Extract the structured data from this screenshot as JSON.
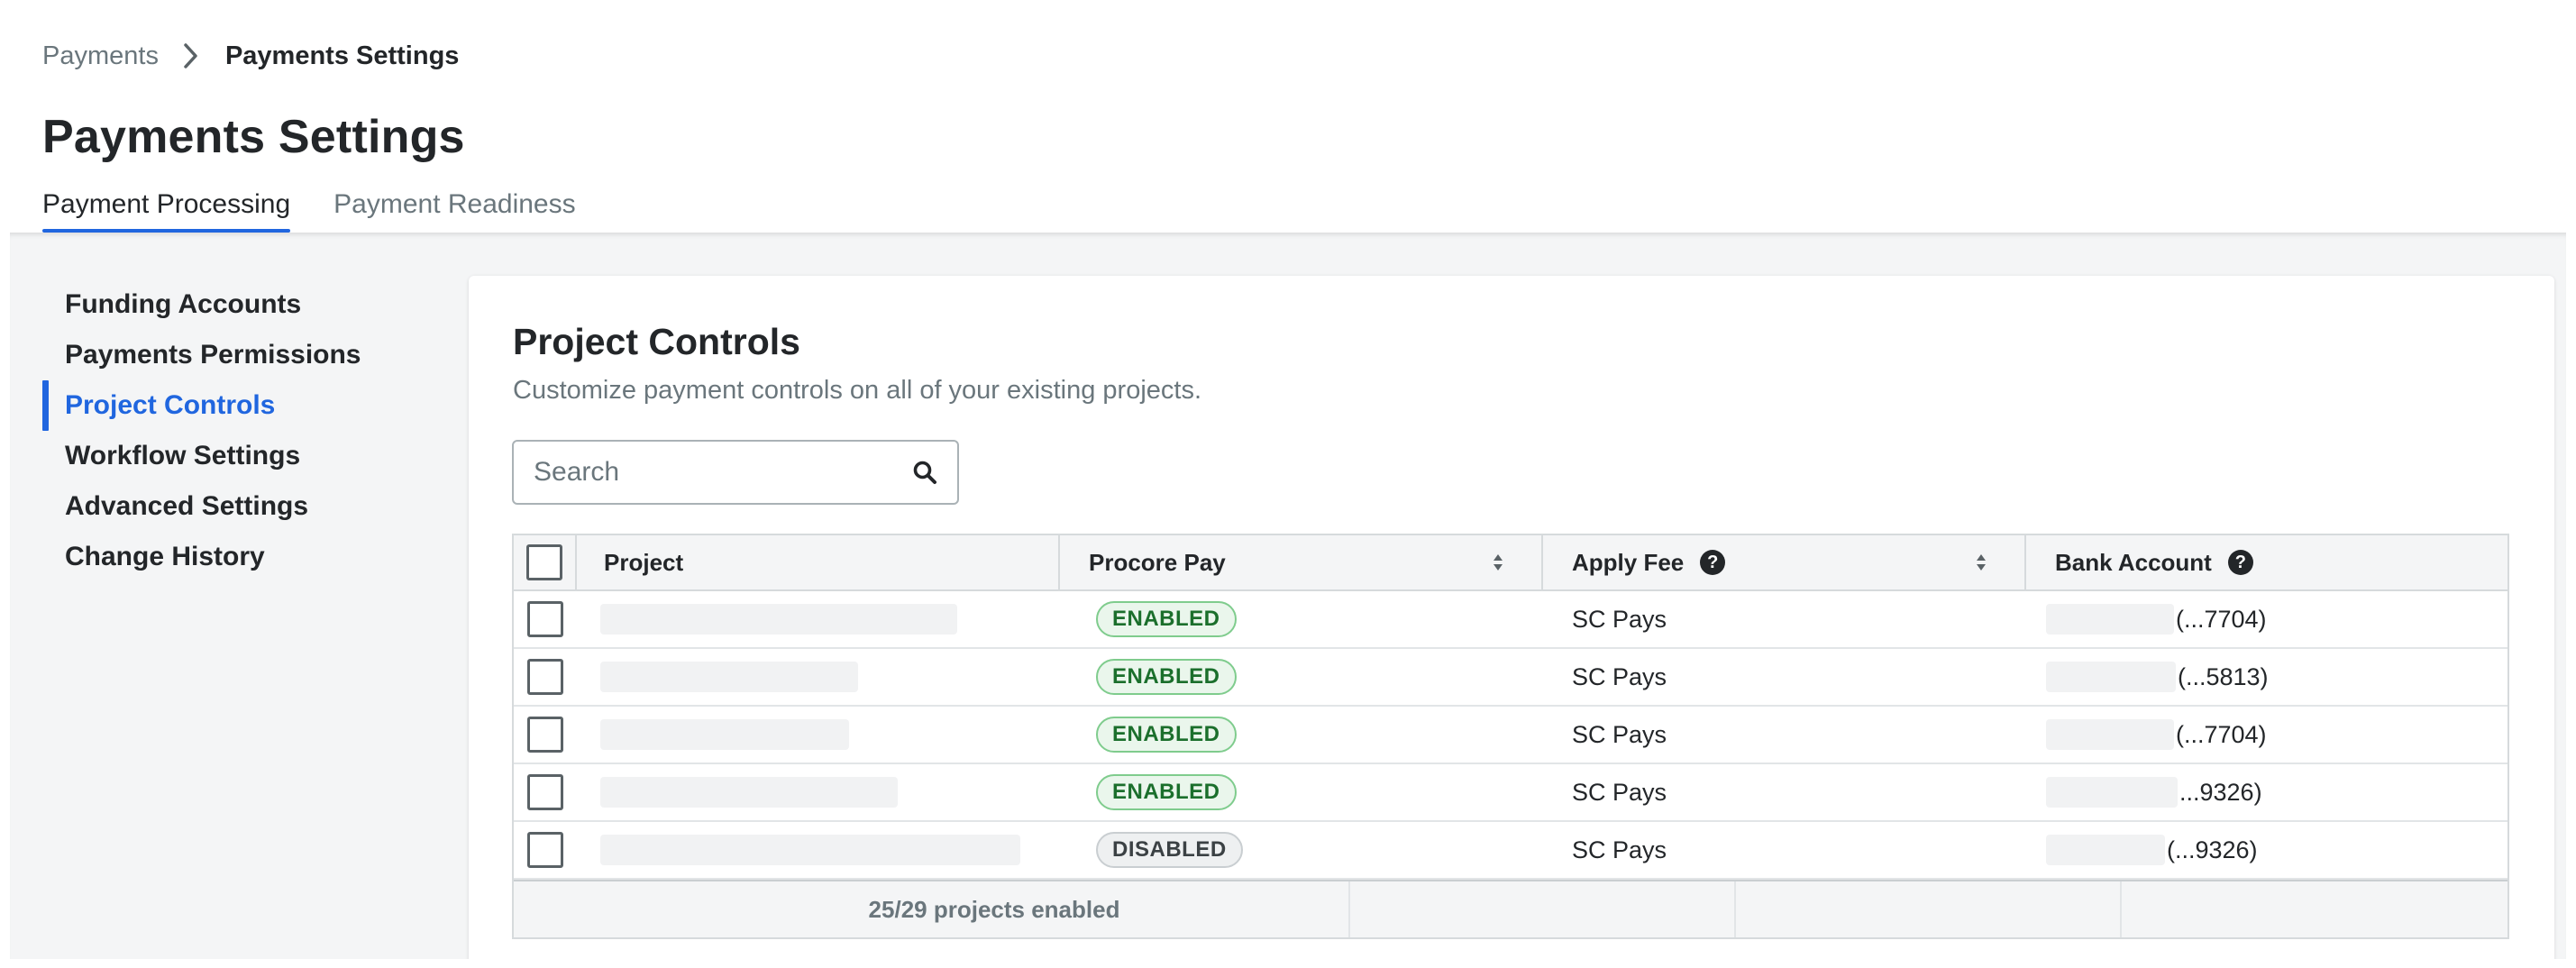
{
  "breadcrumb": {
    "parent": "Payments",
    "current": "Payments Settings"
  },
  "page": {
    "title": "Payments Settings"
  },
  "tabs": [
    {
      "label": "Payment Processing",
      "active": true
    },
    {
      "label": "Payment Readiness",
      "active": false
    }
  ],
  "sidebar": {
    "items": [
      {
        "label": "Funding Accounts"
      },
      {
        "label": "Payments Permissions"
      },
      {
        "label": "Project Controls",
        "active": true
      },
      {
        "label": "Workflow Settings"
      },
      {
        "label": "Advanced Settings"
      },
      {
        "label": "Change History"
      }
    ]
  },
  "card": {
    "title": "Project Controls",
    "description": "Customize payment controls on all of your existing projects."
  },
  "search": {
    "placeholder": "Search",
    "value": ""
  },
  "table": {
    "columns": {
      "project": "Project",
      "procore_pay": "Procore Pay",
      "apply_fee": "Apply Fee",
      "bank_account": "Bank Account"
    },
    "rows": [
      {
        "procore_pay": "ENABLED",
        "apply_fee": "SC Pays",
        "bank_account": "(...7704)"
      },
      {
        "procore_pay": "ENABLED",
        "apply_fee": "SC Pays",
        "bank_account": "(...5813)"
      },
      {
        "procore_pay": "ENABLED",
        "apply_fee": "SC Pays",
        "bank_account": "(...7704)"
      },
      {
        "procore_pay": "ENABLED",
        "apply_fee": "SC Pays",
        "bank_account": "...9326)"
      },
      {
        "procore_pay": "DISABLED",
        "apply_fee": "SC Pays",
        "bank_account": "(...9326)"
      }
    ],
    "footer": {
      "summary": "25/29 projects enabled"
    }
  },
  "colors": {
    "accent": "#2066df",
    "enabled_text": "#1b6f2c",
    "enabled_bg": "#eaf6ec",
    "disabled_text": "#3b4144",
    "disabled_bg": "#eef0f1"
  }
}
